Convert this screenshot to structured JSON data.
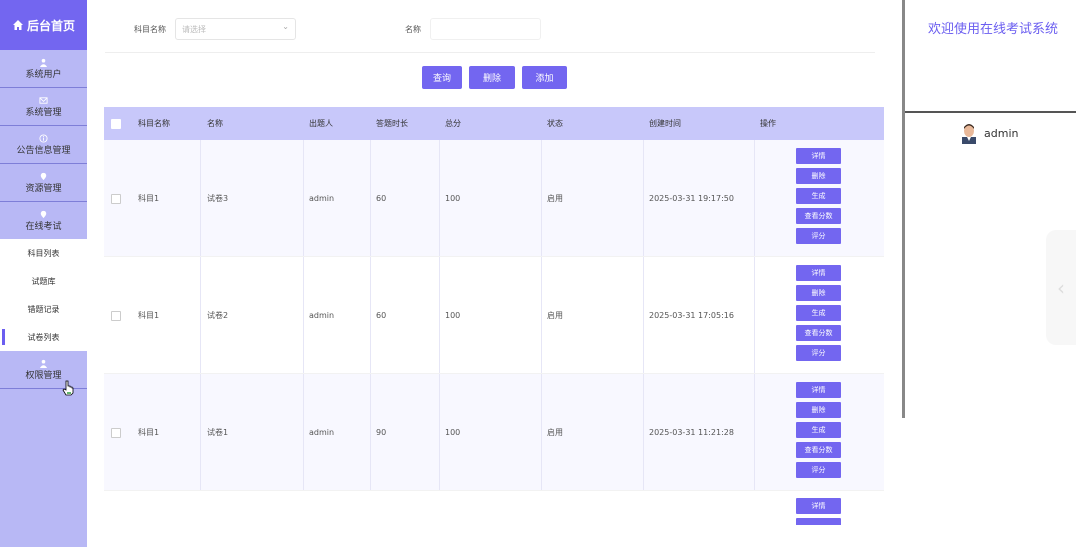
{
  "sidebar": {
    "logo": "后台首页",
    "menus": [
      {
        "label": "系统用户",
        "icon": "user-icon"
      },
      {
        "label": "系统管理",
        "icon": "mail-icon"
      },
      {
        "label": "公告信息管理",
        "icon": "info-icon"
      },
      {
        "label": "资源管理",
        "icon": "location-icon"
      },
      {
        "label": "在线考试",
        "icon": "location-icon"
      }
    ],
    "submenu": [
      "科目列表",
      "试题库",
      "错题记录",
      "试卷列表"
    ],
    "active_submenu": "试卷列表",
    "last_menu": {
      "label": "权限管理",
      "icon": "user-icon"
    }
  },
  "filter": {
    "subject_label": "科目名称",
    "subject_placeholder": "请选择",
    "name_label": "名称",
    "name_value": ""
  },
  "buttons": {
    "query": "查询",
    "delete": "删除",
    "add": "添加"
  },
  "table": {
    "headers": [
      "科目名称",
      "名称",
      "出题人",
      "答题时长",
      "总分",
      "状态",
      "创建时间",
      "操作"
    ],
    "rows": [
      {
        "subject": "科目1",
        "name": "试卷3",
        "author": "admin",
        "duration": "60",
        "score": "100",
        "status": "启用",
        "created": "2025-03-31 19:17:50"
      },
      {
        "subject": "科目1",
        "name": "试卷2",
        "author": "admin",
        "duration": "60",
        "score": "100",
        "status": "启用",
        "created": "2025-03-31 17:05:16"
      },
      {
        "subject": "科目1",
        "name": "试卷1",
        "author": "admin",
        "duration": "90",
        "score": "100",
        "status": "启用",
        "created": "2025-03-31 11:21:28"
      }
    ],
    "row_actions": [
      "详情",
      "删除",
      "生成",
      "查看分数",
      "评分"
    ],
    "partial_row_action": "详情"
  },
  "header": {
    "welcome": "欢迎使用在线考试系统",
    "username": "admin"
  },
  "colors": {
    "accent": "#7366f0",
    "sidebar": "#b8b8f5",
    "table_header": "#c8c8fa"
  }
}
